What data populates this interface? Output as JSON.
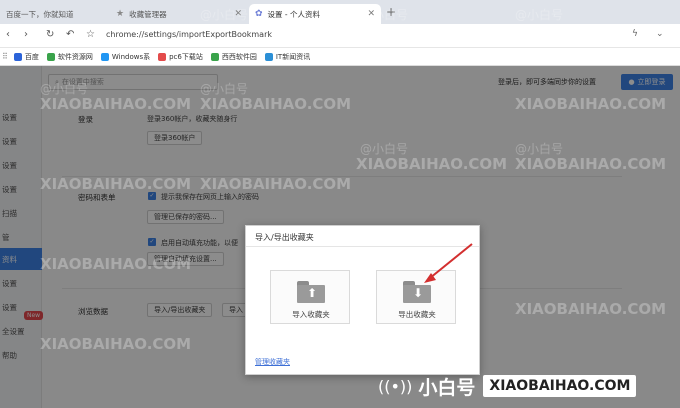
{
  "tabs": [
    {
      "label": "百度一下，你就知道"
    },
    {
      "label": "收藏管理器"
    },
    {
      "label": "设置 - 个人资料"
    }
  ],
  "new_tab_symbol": "+",
  "address": {
    "url": "chrome://settings/importExportBookmark"
  },
  "bookmarks": [
    {
      "label": "百度",
      "color": "#2b63d9"
    },
    {
      "label": "软件资源网",
      "color": "#3aa34b"
    },
    {
      "label": "Windows系",
      "color": "#2196f3"
    },
    {
      "label": "pc6下载站",
      "color": "#e34b4b"
    },
    {
      "label": "西西软件园",
      "color": "#3aa34b"
    },
    {
      "label": "IT新闻资讯",
      "color": "#2b8fd6"
    }
  ],
  "sidebar": {
    "items": [
      {
        "label": "设置"
      },
      {
        "label": "设置"
      },
      {
        "label": "设置"
      },
      {
        "label": "设置"
      },
      {
        "label": "扫描"
      },
      {
        "label": "管"
      },
      {
        "label": "资料"
      },
      {
        "label": "设置"
      },
      {
        "label": "设置"
      },
      {
        "label": "全设置"
      },
      {
        "label": "帮助"
      }
    ],
    "new_badge": "New"
  },
  "search": {
    "placeholder": "在设置中搜索"
  },
  "top_tip": "登录后，即可多端同步你的设置",
  "login_button": "立即登录",
  "login_section": {
    "title": "登录",
    "desc": "登录360帐户，收藏夹随身行",
    "button": "登录360帐户"
  },
  "password_section": {
    "title": "密码和表单",
    "check1": "提示我保存在网页上输入的密码",
    "button1": "管理已保存的密码...",
    "check2": "启用自动填充功能，以便",
    "button2": "管理自动填充设置..."
  },
  "browse_section": {
    "title": "浏览数据",
    "button1": "导入/导出收藏夹",
    "button2": "导入"
  },
  "dialog": {
    "title": "导入/导出收藏夹",
    "import_label": "导入收藏夹",
    "export_label": "导出收藏夹",
    "manage_link": "管理收藏夹"
  },
  "watermark": {
    "text": "XIAOBAIHAO.COM",
    "cn": "@小白号",
    "brand_cn": "小白号",
    "brand_en": "XIAOBAIHAO.COM"
  },
  "colors": {
    "accent": "#3d82e6",
    "arrow": "#d32f2f"
  }
}
